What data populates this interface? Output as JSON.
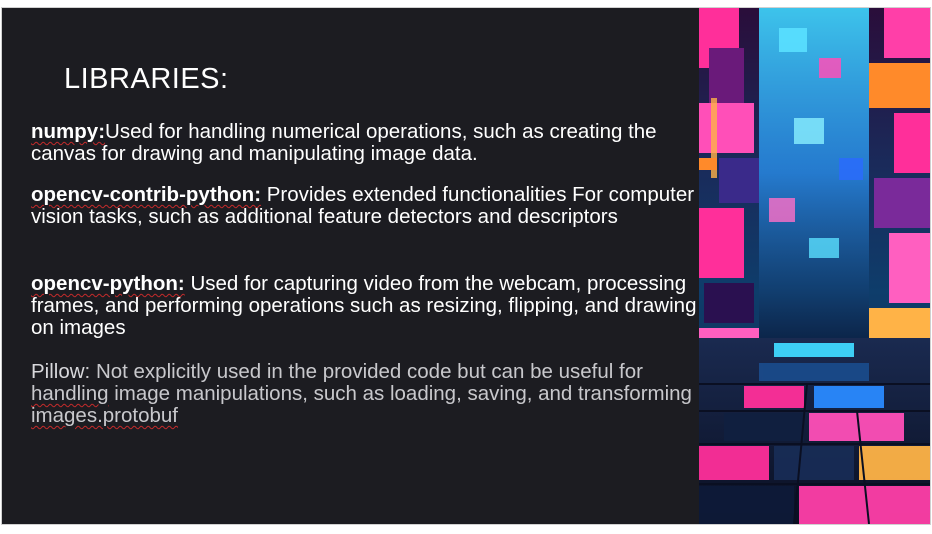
{
  "slide": {
    "title": "LIBRARIES:",
    "libraries": [
      {
        "name": "numpy:",
        "description": "Used for handling numerical operations, such as creating the canvas for drawing and manipulating image data."
      },
      {
        "name": "opencv-contrib-python:",
        "description": " Provides extended functionalities For computer vision tasks, such as additional feature detectors and descriptors"
      },
      {
        "name": "opencv-python:",
        "description": " Used for capturing video from the webcam, processing frames, and performing operations such as resizing, flipping, and drawing on images"
      },
      {
        "name": "Pillow",
        "description_parts": [
          ": Not explicitly used in the provided code but can be useful for ",
          "handling",
          " image manipulations, such as loading, saving, and transforming ",
          "images.protobuf"
        ]
      }
    ]
  },
  "colors": {
    "slide_background": "#1c1c21",
    "text_primary": "#ffffff",
    "text_muted": "#c8c8cc",
    "spellcheck_underline": "#c42b2b",
    "art_magenta": "#ff2f9a",
    "art_cyan": "#3fd8ff",
    "art_orange": "#ff8a2a"
  },
  "decorative_image": {
    "icon": "neon-cube-corridor-image"
  }
}
